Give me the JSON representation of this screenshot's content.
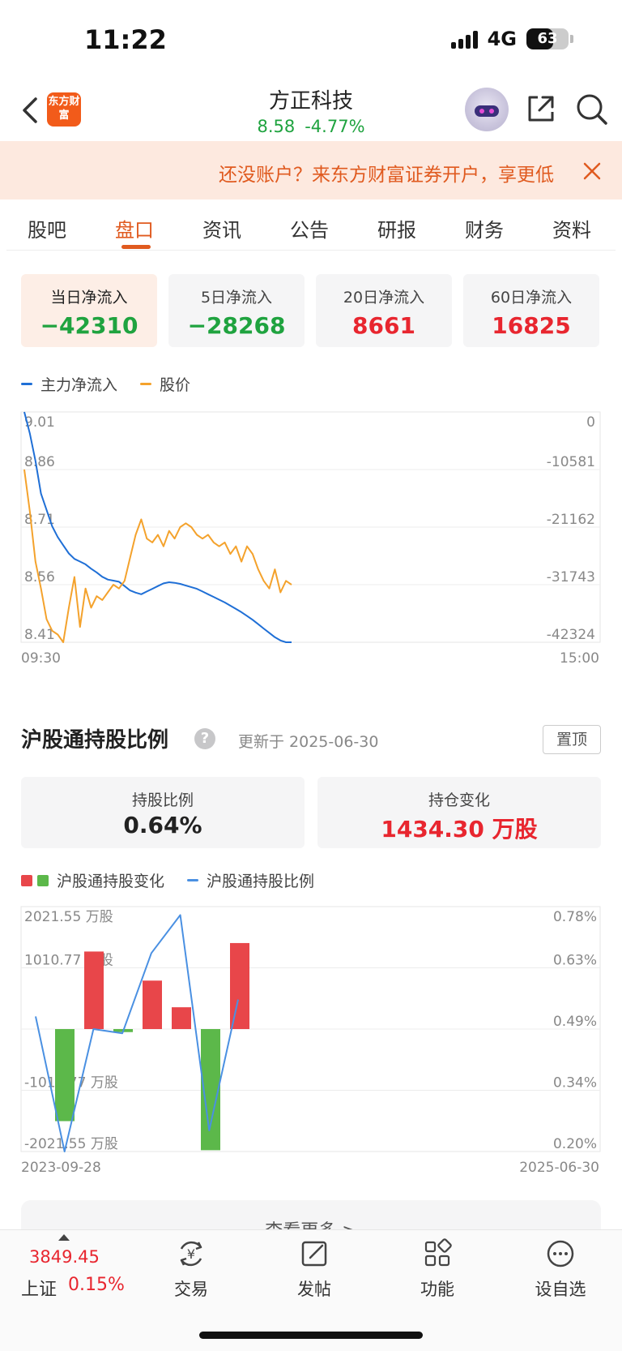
{
  "status_bar": {
    "time": "11:22",
    "network": "4G",
    "battery": "63",
    "battery_level": 0.63
  },
  "header": {
    "logo_text": "东方财富",
    "stock_name": "方正科技",
    "price": "8.58",
    "change_pct": "-4.77%"
  },
  "banner": {
    "text": "还没账户？来东方财富证券开户，享更低"
  },
  "tabs": [
    {
      "label": "股吧"
    },
    {
      "label": "盘口"
    },
    {
      "label": "资讯"
    },
    {
      "label": "公告"
    },
    {
      "label": "研报"
    },
    {
      "label": "财务"
    },
    {
      "label": "资料"
    }
  ],
  "active_tab": "盘口",
  "flow_cards": [
    {
      "label": "当日净流入",
      "value": "−42310",
      "color": "#1fa33f",
      "active": true
    },
    {
      "label": "5日净流入",
      "value": "−28268",
      "color": "#1fa33f"
    },
    {
      "label": "20日净流入",
      "value": "8661",
      "color": "#e8262f"
    },
    {
      "label": "60日净流入",
      "value": "16825",
      "color": "#e8262f"
    }
  ],
  "flow_legend": {
    "main_flow": "主力净流入",
    "price": "股价",
    "main_flow_color": "#1f6fd6",
    "price_color": "#f4a22c"
  },
  "chart_data": [
    {
      "type": "line",
      "x_start": "09:30",
      "x_end": "15:00",
      "left_axis_ticks": [
        "9.01",
        "8.86",
        "8.71",
        "8.56",
        "8.41"
      ],
      "right_axis_ticks": [
        "0",
        "-10581",
        "-21162",
        "-31743",
        "-42324"
      ],
      "ylim_left": [
        8.41,
        9.01
      ],
      "ylim_right": [
        -42324,
        0
      ],
      "series": [
        {
          "name": "主力净流入",
          "axis": "right",
          "values": [
            0,
            -4000,
            -9000,
            -15000,
            -18000,
            -21000,
            -23000,
            -24500,
            -26000,
            -27000,
            -27500,
            -28000,
            -28800,
            -29500,
            -30300,
            -30800,
            -31000,
            -31200,
            -32000,
            -32800,
            -33200,
            -33500,
            -33000,
            -32500,
            -32000,
            -31500,
            -31300,
            -31400,
            -31600,
            -31900,
            -32200,
            -32500,
            -33000,
            -33500,
            -34000,
            -34500,
            -35000,
            -35600,
            -36200,
            -36800,
            -37500,
            -38200,
            -39000,
            -39800,
            -40600,
            -41400,
            -42000,
            -42324,
            -42324
          ]
        },
        {
          "name": "股价",
          "axis": "left",
          "values": [
            8.86,
            8.75,
            8.62,
            8.55,
            8.47,
            8.44,
            8.43,
            8.41,
            8.5,
            8.58,
            8.45,
            8.55,
            8.5,
            8.53,
            8.52,
            8.54,
            8.56,
            8.55,
            8.57,
            8.63,
            8.69,
            8.73,
            8.68,
            8.67,
            8.69,
            8.66,
            8.7,
            8.68,
            8.71,
            8.72,
            8.71,
            8.69,
            8.68,
            8.69,
            8.67,
            8.66,
            8.67,
            8.64,
            8.66,
            8.62,
            8.66,
            8.64,
            8.6,
            8.57,
            8.55,
            8.6,
            8.54,
            8.57,
            8.56
          ]
        }
      ]
    },
    {
      "type": "bar",
      "x_start": "2023-09-28",
      "x_end": "2025-06-30",
      "left_axis_ticks": [
        "2021.55 万股",
        "1010.77 万股",
        "-1010.77 万股",
        "-2021.55 万股"
      ],
      "right_axis_ticks": [
        "0.78%",
        "0.63%",
        "0.49%",
        "0.34%",
        "0.20%"
      ],
      "ylim_left": [
        -2021.55,
        2021.55
      ],
      "ylim_right": [
        0.2,
        0.78
      ],
      "series": [
        {
          "name": "沪股通持股变化",
          "values": [
            -1520,
            1280,
            -50,
            800,
            360,
            -2000,
            1420
          ]
        },
        {
          "name": "沪股通持股比例",
          "values": [
            0.52,
            0.2,
            0.49,
            0.48,
            0.67,
            0.76,
            0.25,
            0.56
          ]
        }
      ]
    }
  ],
  "hsgt": {
    "title": "沪股通持股比例",
    "help": "?",
    "updated": "更新于 2025-06-30",
    "pin_label": "置顶",
    "ratio_label": "持股比例",
    "ratio_value": "0.64%",
    "change_label": "持仓变化",
    "change_value": "1434.30 万股",
    "change_color": "#e8262f",
    "legend_change": "沪股通持股变化",
    "legend_ratio": "沪股通持股比例",
    "bar_up_color": "#e8464a",
    "bar_down_color": "#5cb84a",
    "line_color": "#4a90e2"
  },
  "more_button": "查看更多 >",
  "bottom_bar": {
    "index_value": "3849.45",
    "index_name": "上证",
    "index_change": "0.15%",
    "nav": [
      {
        "label": "交易",
        "icon": "trade-yen-icon"
      },
      {
        "label": "发帖",
        "icon": "compose-icon"
      },
      {
        "label": "功能",
        "icon": "apps-grid-icon"
      },
      {
        "label": "设自选",
        "icon": "more-dots-icon"
      }
    ]
  }
}
